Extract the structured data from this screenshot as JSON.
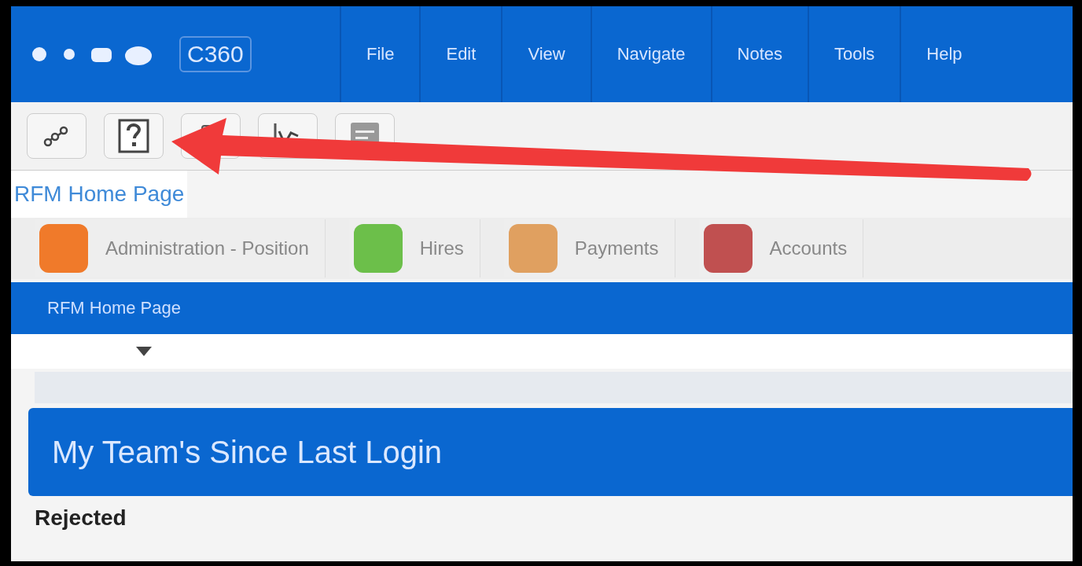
{
  "header": {
    "product": "C360",
    "menu": [
      {
        "label": "File"
      },
      {
        "label": "Edit"
      },
      {
        "label": "View"
      },
      {
        "label": "Navigate"
      },
      {
        "label": "Notes"
      },
      {
        "label": "Tools"
      },
      {
        "label": "Help"
      }
    ]
  },
  "toolbar": [
    {
      "kind": "network"
    },
    {
      "kind": "help"
    },
    {
      "kind": "clipboard"
    },
    {
      "kind": "chart"
    },
    {
      "kind": "notes"
    }
  ],
  "annotation": {
    "kind": "arrow"
  },
  "breadcrumb": "RFM Home Page",
  "modules": [
    {
      "label": "Administration - Position",
      "color": "#f07a2a"
    },
    {
      "label": "Hires",
      "color": "#6cbf4a"
    },
    {
      "label": "Payments",
      "color": "#e0a060"
    },
    {
      "label": "Accounts",
      "color": "#c05050"
    }
  ],
  "page_bar": "RFM Home Page",
  "panel": {
    "title": "My Team's Since Last Login",
    "section": "Rejected"
  }
}
